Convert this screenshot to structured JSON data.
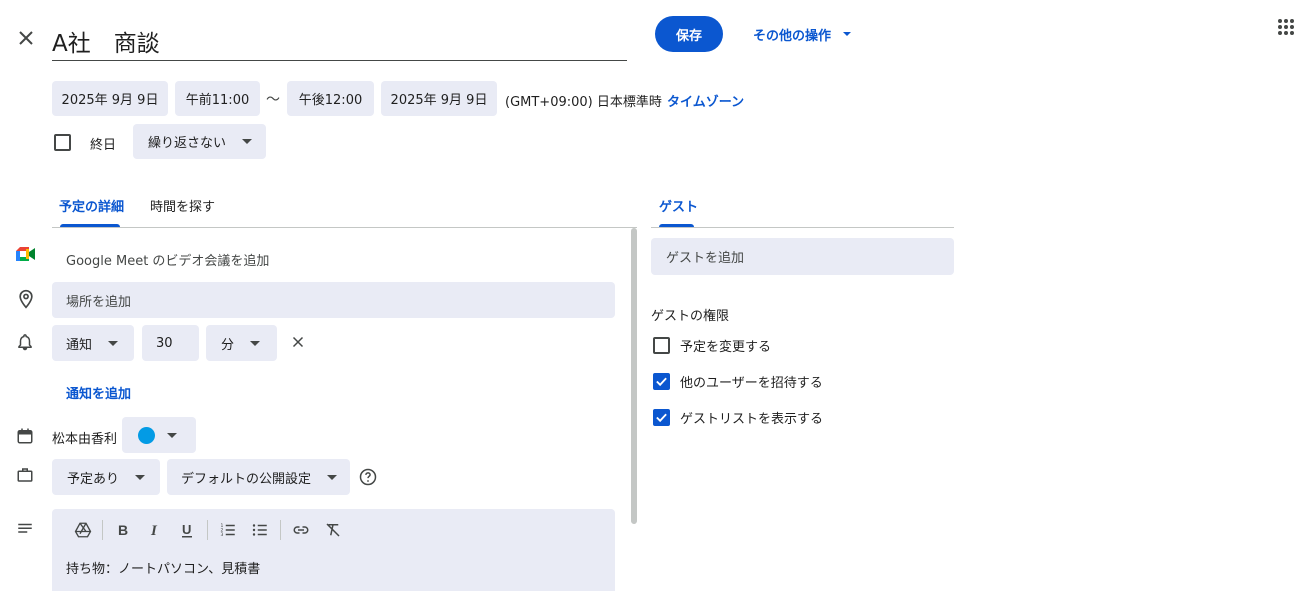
{
  "header": {
    "title": "A社　商談",
    "save_label": "保存",
    "more_actions_label": "その他の操作"
  },
  "datetime": {
    "start_date": "2025年 9月 9日",
    "start_time": "午前11:00",
    "separator": "～",
    "end_time": "午後12:00",
    "end_date": "2025年 9月 9日",
    "timezone_text": "(GMT+09:00) 日本標準時",
    "timezone_link": "タイムゾーン"
  },
  "options": {
    "all_day_label": "終日",
    "all_day_checked": false,
    "repeat_value": "繰り返さない"
  },
  "tabs": [
    {
      "label": "予定の詳細",
      "active": true
    },
    {
      "label": "時間を探す",
      "active": false
    }
  ],
  "details": {
    "meet_label": "Google Meet のビデオ会議を追加",
    "location_placeholder": "場所を追加",
    "notification": {
      "type": "通知",
      "amount": "30",
      "unit": "分"
    },
    "add_notification_label": "通知を追加",
    "calendar_owner": "松本由香利",
    "calendar_color": "#039be5",
    "availability": "予定あり",
    "visibility": "デフォルトの公開設定",
    "description": "持ち物：ノートパソコン、見積書"
  },
  "guests": {
    "tab_label": "ゲスト",
    "add_placeholder": "ゲストを追加",
    "permissions_title": "ゲストの権限",
    "permissions": [
      {
        "label": "予定を変更する",
        "checked": false
      },
      {
        "label": "他のユーザーを招待する",
        "checked": true
      },
      {
        "label": "ゲストリストを表示する",
        "checked": true
      }
    ]
  },
  "colors": {
    "accent": "#0b57d0",
    "chip_bg": "#e9ebf5"
  }
}
